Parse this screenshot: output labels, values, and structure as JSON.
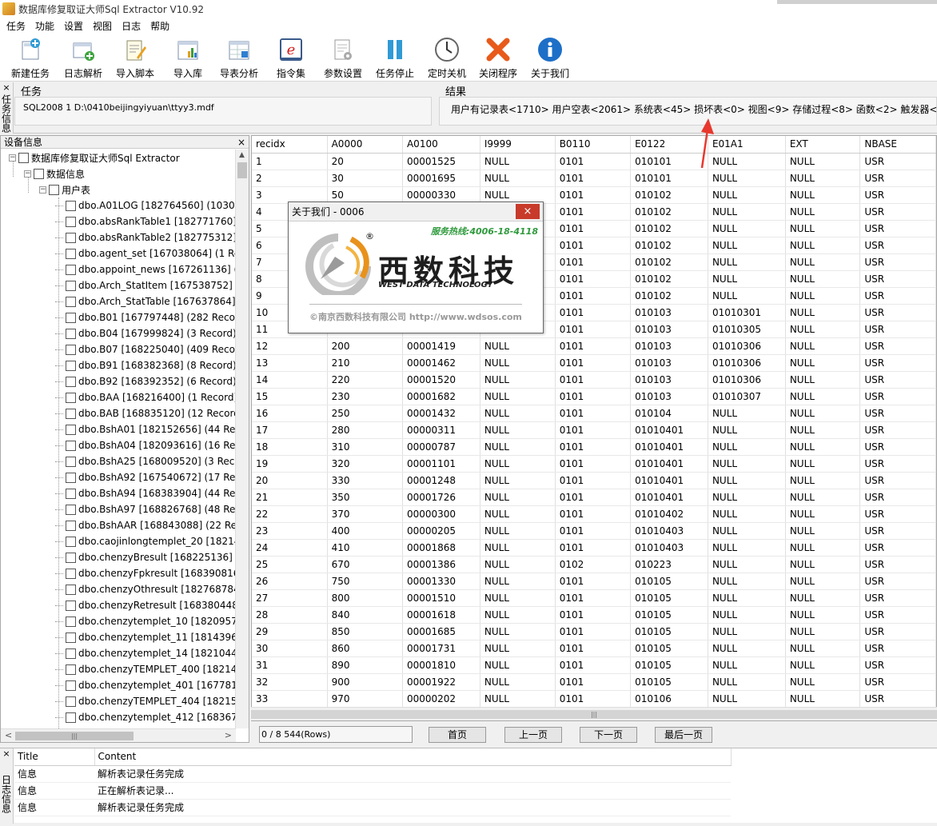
{
  "window": {
    "title": "数据库修复取证大师Sql Extractor V10.92"
  },
  "menu": [
    "任务",
    "功能",
    "设置",
    "视图",
    "日志",
    "帮助"
  ],
  "toolbar": [
    {
      "label": "新建任务",
      "icon": "new-task-icon"
    },
    {
      "label": "日志解析",
      "icon": "log-parse-icon"
    },
    {
      "label": "导入脚本",
      "icon": "import-script-icon"
    },
    {
      "label": "导入库",
      "icon": "import-db-icon"
    },
    {
      "label": "导表分析",
      "icon": "table-analysis-icon"
    },
    {
      "label": "指令集",
      "icon": "command-set-icon"
    },
    {
      "label": "参数设置",
      "icon": "settings-icon"
    },
    {
      "label": "任务停止",
      "icon": "pause-icon"
    },
    {
      "label": "定时关机",
      "icon": "clock-icon"
    },
    {
      "label": "关闭程序",
      "icon": "close-x-icon"
    },
    {
      "label": "关于我们",
      "icon": "info-icon"
    }
  ],
  "task_panel": {
    "side_label": "任务信息",
    "task_title": "任务",
    "task_value": "SQL2008 1 D:\\0410beijingyiyuan\\ttyy3.mdf",
    "result_title": "结果",
    "result_value": "用户有记录表<1710> 用户空表<2061> 系统表<45> 损坏表<0> 视图<9> 存储过程<8> 函数<2> 触发器<7> 自定义"
  },
  "device_panel": {
    "title": "设备信息",
    "close": "×",
    "root": "数据库修复取证大师Sql Extractor",
    "level1": "数据信息",
    "level2": "用户表",
    "items": [
      "dbo.A01LOG [182764560] (10306",
      "dbo.absRankTable1 [182771760]",
      "dbo.absRankTable2 [182775312]",
      "dbo.agent_set [167038064] (1 Rec",
      "dbo.appoint_news [167261136] (4",
      "dbo.Arch_StatItem [167538752] (4",
      "dbo.Arch_StatTable [167637864] (",
      "dbo.B01 [167797448] (282 Record",
      "dbo.B04 [167999824] (3 Record)",
      "dbo.B07 [168225040] (409 Record",
      "dbo.B91 [168382368] (8 Record)",
      "dbo.B92 [168392352] (6 Record)",
      "dbo.BAA [168216400] (1 Record)",
      "dbo.BAB [168835120] (12 Record)",
      "dbo.BshA01 [182152656] (44 Reco",
      "dbo.BshA04 [182093616] (16 Reco",
      "dbo.BshA25 [168009520] (3 Recor",
      "dbo.BshA92 [167540672] (17 Reco",
      "dbo.BshA94 [168383904] (44 Reco",
      "dbo.BshA97 [168826768] (48 Reco",
      "dbo.BshAAR [168843088] (22 Rec",
      "dbo.caojinlongtemplet_20 [18214",
      "dbo.chenzyBresult [168225136] (2",
      "dbo.chenzyFpkresult [168390816]",
      "dbo.chenzyOthresult [182768784]",
      "dbo.chenzyRetresult [168380448]",
      "dbo.chenzytemplet_10 [18209572",
      "dbo.chenzytemplet_11 [18143964",
      "dbo.chenzytemplet_14 [18210446",
      "dbo.chenzyTEMPLET_400 [182140",
      "dbo.chenzytemplet_401 [1677818",
      "dbo.chenzyTEMPLET_404 [182154",
      "dbo.chenzytemplet_412 [1683678"
    ]
  },
  "grid": {
    "columns": [
      "recidx",
      "A0000",
      "A0100",
      "I9999",
      "B0110",
      "E0122",
      "E01A1",
      "EXT",
      "NBASE"
    ],
    "rows": [
      [
        "1",
        "20",
        "00001525",
        "NULL",
        "0101",
        "010101",
        "NULL",
        "NULL",
        "USR"
      ],
      [
        "2",
        "30",
        "00001695",
        "NULL",
        "0101",
        "010101",
        "NULL",
        "NULL",
        "USR"
      ],
      [
        "3",
        "50",
        "00000330",
        "NULL",
        "0101",
        "010102",
        "NULL",
        "NULL",
        "USR"
      ],
      [
        "4",
        "",
        "",
        "",
        "0101",
        "010102",
        "NULL",
        "NULL",
        "USR"
      ],
      [
        "5",
        "",
        "",
        "",
        "0101",
        "010102",
        "NULL",
        "NULL",
        "USR"
      ],
      [
        "6",
        "",
        "",
        "",
        "0101",
        "010102",
        "NULL",
        "NULL",
        "USR"
      ],
      [
        "7",
        "",
        "",
        "",
        "0101",
        "010102",
        "NULL",
        "NULL",
        "USR"
      ],
      [
        "8",
        "",
        "",
        "",
        "0101",
        "010102",
        "NULL",
        "NULL",
        "USR"
      ],
      [
        "9",
        "",
        "",
        "",
        "0101",
        "010102",
        "NULL",
        "NULL",
        "USR"
      ],
      [
        "10",
        "",
        "",
        "",
        "0101",
        "010103",
        "01010301",
        "NULL",
        "USR"
      ],
      [
        "11",
        "",
        "",
        "",
        "0101",
        "010103",
        "01010305",
        "NULL",
        "USR"
      ],
      [
        "12",
        "200",
        "00001419",
        "NULL",
        "0101",
        "010103",
        "01010306",
        "NULL",
        "USR"
      ],
      [
        "13",
        "210",
        "00001462",
        "NULL",
        "0101",
        "010103",
        "01010306",
        "NULL",
        "USR"
      ],
      [
        "14",
        "220",
        "00001520",
        "NULL",
        "0101",
        "010103",
        "01010306",
        "NULL",
        "USR"
      ],
      [
        "15",
        "230",
        "00001682",
        "NULL",
        "0101",
        "010103",
        "01010307",
        "NULL",
        "USR"
      ],
      [
        "16",
        "250",
        "00001432",
        "NULL",
        "0101",
        "010104",
        "NULL",
        "NULL",
        "USR"
      ],
      [
        "17",
        "280",
        "00000311",
        "NULL",
        "0101",
        "01010401",
        "NULL",
        "NULL",
        "USR"
      ],
      [
        "18",
        "310",
        "00000787",
        "NULL",
        "0101",
        "01010401",
        "NULL",
        "NULL",
        "USR"
      ],
      [
        "19",
        "320",
        "00001101",
        "NULL",
        "0101",
        "01010401",
        "NULL",
        "NULL",
        "USR"
      ],
      [
        "20",
        "330",
        "00001248",
        "NULL",
        "0101",
        "01010401",
        "NULL",
        "NULL",
        "USR"
      ],
      [
        "21",
        "350",
        "00001726",
        "NULL",
        "0101",
        "01010401",
        "NULL",
        "NULL",
        "USR"
      ],
      [
        "22",
        "370",
        "00000300",
        "NULL",
        "0101",
        "01010402",
        "NULL",
        "NULL",
        "USR"
      ],
      [
        "23",
        "400",
        "00000205",
        "NULL",
        "0101",
        "01010403",
        "NULL",
        "NULL",
        "USR"
      ],
      [
        "24",
        "410",
        "00001868",
        "NULL",
        "0101",
        "01010403",
        "NULL",
        "NULL",
        "USR"
      ],
      [
        "25",
        "670",
        "00001386",
        "NULL",
        "0102",
        "010223",
        "NULL",
        "NULL",
        "USR"
      ],
      [
        "26",
        "750",
        "00001330",
        "NULL",
        "0101",
        "010105",
        "NULL",
        "NULL",
        "USR"
      ],
      [
        "27",
        "800",
        "00001510",
        "NULL",
        "0101",
        "010105",
        "NULL",
        "NULL",
        "USR"
      ],
      [
        "28",
        "840",
        "00001618",
        "NULL",
        "0101",
        "010105",
        "NULL",
        "NULL",
        "USR"
      ],
      [
        "29",
        "850",
        "00001685",
        "NULL",
        "0101",
        "010105",
        "NULL",
        "NULL",
        "USR"
      ],
      [
        "30",
        "860",
        "00001731",
        "NULL",
        "0101",
        "010105",
        "NULL",
        "NULL",
        "USR"
      ],
      [
        "31",
        "890",
        "00001810",
        "NULL",
        "0101",
        "010105",
        "NULL",
        "NULL",
        "USR"
      ],
      [
        "32",
        "900",
        "00001922",
        "NULL",
        "0101",
        "010105",
        "NULL",
        "NULL",
        "USR"
      ],
      [
        "33",
        "970",
        "00000202",
        "NULL",
        "0101",
        "010106",
        "NULL",
        "NULL",
        "USR"
      ]
    ]
  },
  "pager": {
    "rows_info": "0 / 8 544(Rows)",
    "first": "首页",
    "prev": "上一页",
    "next": "下一页",
    "last": "最后一页"
  },
  "log_panel": {
    "side_label": "日志信息",
    "columns": [
      "Title",
      "Content"
    ],
    "rows": [
      [
        "信息",
        "解析表记录任务完成"
      ],
      [
        "信息",
        "正在解析表记录..."
      ],
      [
        "信息",
        "解析表记录任务完成"
      ]
    ]
  },
  "dialog": {
    "title": "关于我们 - 0006",
    "close": "×",
    "hotline": "服务热线:4006-18-4118",
    "brand_cn": "西数科技",
    "brand_en": "WEST DATA TECHNOLOGY",
    "registered": "®",
    "footer": "©南京西数科技有限公司  http://www.wdsos.com"
  },
  "colors": {
    "accent_red": "#c83a2a",
    "hotline_green": "#2e9a3c",
    "arrow_red": "#e8382e"
  }
}
